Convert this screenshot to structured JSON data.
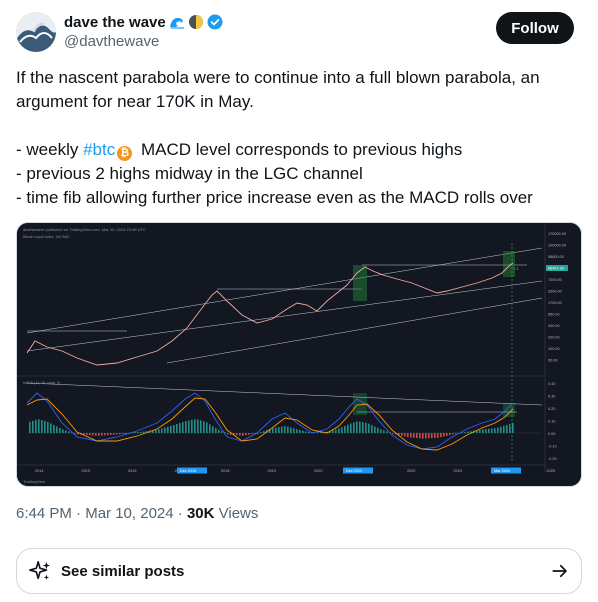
{
  "author": {
    "name": "dave the wave",
    "handle": "@davthewave",
    "emoji_icons": [
      "wave-icon",
      "half-moon-icon"
    ],
    "verified_icon": "verified-badge-icon"
  },
  "follow_label": "Follow",
  "tweet": {
    "line1": "If the nascent parabola were to continue into a full blown parabola, an argument for near 170K in May.",
    "bullet1_pre": "- weekly ",
    "bullet1_tag": "#btc",
    "bullet1_post": " MACD level corresponds to previous highs",
    "bullet2": "- previous 2 highs midway in the LGC channel",
    "bullet3": "- time fib allowing further price increase even as the MACD rolls over",
    "coin_symbol": "₿"
  },
  "chart": {
    "header": "davthewave published on TradingView.com, Mar 10, 2024 23:48 UTC",
    "symbol": "Bitcoin Liquid Index, 1W, BNC",
    "macd_label": "MACD (12, 26, close, 9)",
    "watermark": "TradingView",
    "price_badge": "68457.39",
    "right_badge": "1.3",
    "x_labels": [
      "2014",
      "2015",
      "2016",
      "2017",
      "2018",
      "2019",
      "2020",
      "2021",
      "2022",
      "2023",
      "2024",
      "2025"
    ],
    "x_highlights": [
      "Dec 2016",
      "Dec 2020",
      "Mar 2024"
    ],
    "price_ticks": [
      "170000.00",
      "100000.00",
      "58800.00",
      "14000.00",
      "7000.00",
      "3500.00",
      "1700.00",
      "850.00",
      "400.00",
      "200.00",
      "100.00",
      "50.00"
    ],
    "macd_ticks": [
      "0.40",
      "0.30",
      "0.20",
      "0.10",
      "0.00",
      "-0.10",
      "-0.20"
    ],
    "colors": {
      "price": "#f0a8a0",
      "up": "#26a69a",
      "down": "#ef5350",
      "macd": "#2962ff",
      "signal": "#ff9800",
      "box": "#1e8f3a"
    }
  },
  "meta": {
    "time": "6:44 PM",
    "sep1": " · ",
    "date": "Mar 10, 2024",
    "sep2": " · ",
    "views_count": "30K",
    "views_label": " Views"
  },
  "similar_label": "See similar posts"
}
